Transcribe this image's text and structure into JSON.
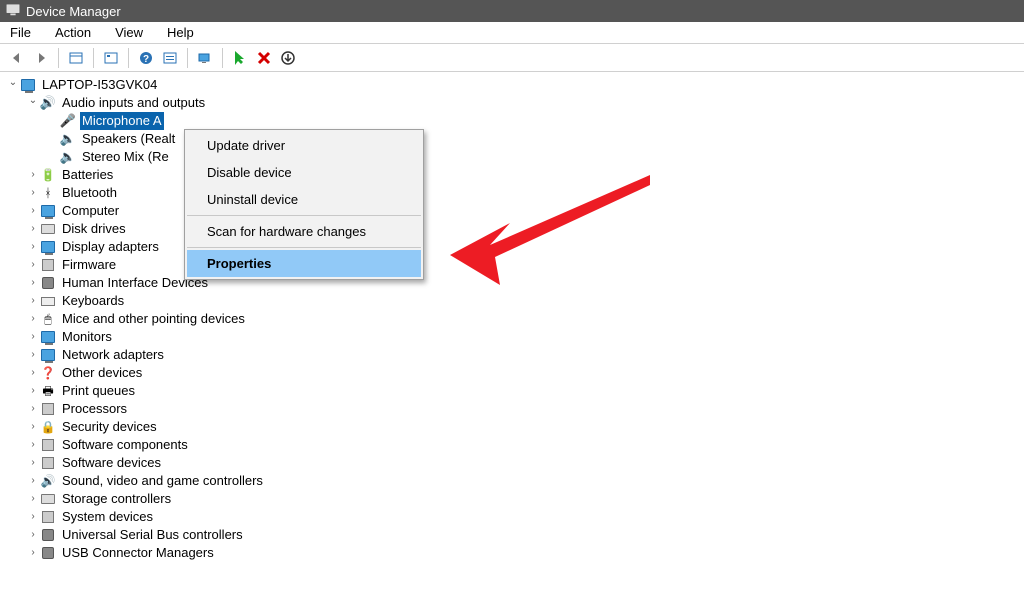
{
  "title": "Device Manager",
  "menus": [
    "File",
    "Action",
    "View",
    "Help"
  ],
  "root": "LAPTOP-I53GVK04",
  "audio_category": "Audio inputs and outputs",
  "audio_children": {
    "mic": "Microphone A",
    "speakers": "Speakers (Realt",
    "stereo": "Stereo Mix (Re"
  },
  "categories": [
    "Batteries",
    "Bluetooth",
    "Computer",
    "Disk drives",
    "Display adapters",
    "Firmware",
    "Human Interface Devices",
    "Keyboards",
    "Mice and other pointing devices",
    "Monitors",
    "Network adapters",
    "Other devices",
    "Print queues",
    "Processors",
    "Security devices",
    "Software components",
    "Software devices",
    "Sound, video and game controllers",
    "Storage controllers",
    "System devices",
    "Universal Serial Bus controllers",
    "USB Connector Managers"
  ],
  "context_menu": {
    "update": "Update driver",
    "disable": "Disable device",
    "uninstall": "Uninstall device",
    "scan": "Scan for hardware changes",
    "props": "Properties"
  }
}
